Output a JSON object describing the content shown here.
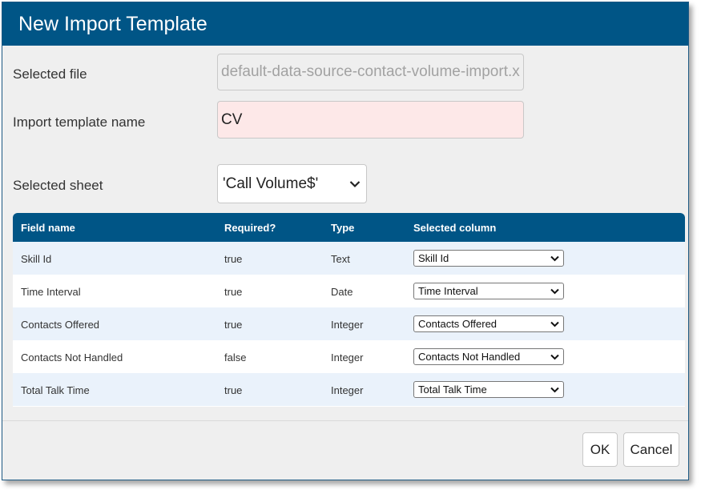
{
  "dialog": {
    "title": "New Import Template"
  },
  "form": {
    "selected_file_label": "Selected file",
    "selected_file_value": "default-data-source-contact-volume-import.xlsx",
    "template_name_label": "Import template name",
    "template_name_value": "CV",
    "sheet_label": "Selected sheet",
    "sheet_value": "'Call Volume$'"
  },
  "table": {
    "headers": [
      "Field name",
      "Required?",
      "Type",
      "Selected column"
    ],
    "rows": [
      {
        "field": "Skill Id",
        "required": "true",
        "type": "Text",
        "column": "Skill Id"
      },
      {
        "field": "Time Interval",
        "required": "true",
        "type": "Date",
        "column": "Time Interval"
      },
      {
        "field": "Contacts Offered",
        "required": "true",
        "type": "Integer",
        "column": "Contacts Offered"
      },
      {
        "field": "Contacts Not Handled",
        "required": "false",
        "type": "Integer",
        "column": "Contacts Not Handled"
      },
      {
        "field": "Total Talk Time",
        "required": "true",
        "type": "Integer",
        "column": "Total Talk Time"
      }
    ]
  },
  "buttons": {
    "ok": "OK",
    "cancel": "Cancel"
  },
  "icons": {
    "dropdown": "chevron-down-icon"
  },
  "colors": {
    "header_bg": "#005586",
    "dialog_bg": "#efefef",
    "required_field_bg": "#fde8e8",
    "row_alt_bg": "#eaf2fb"
  }
}
